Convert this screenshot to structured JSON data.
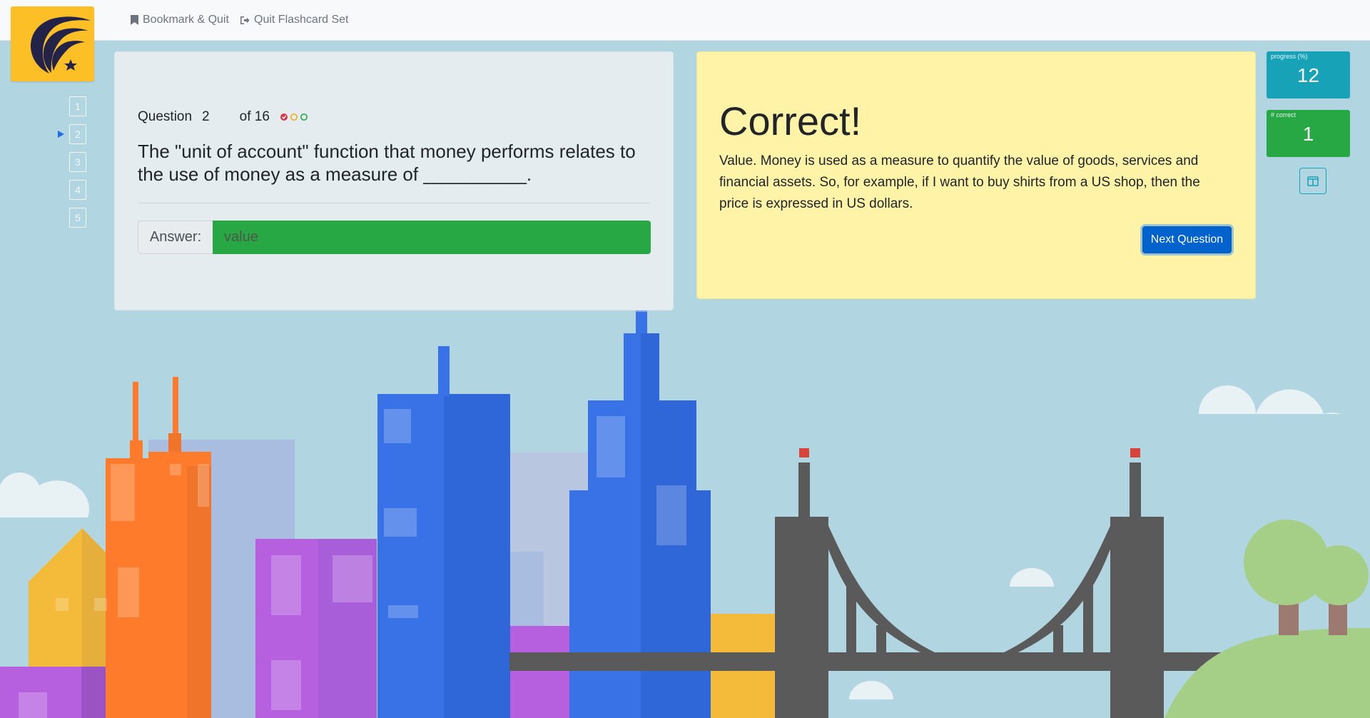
{
  "nav": {
    "bookmark_label": "Bookmark & Quit",
    "quit_label": "Quit Flashcard Set"
  },
  "sidebar": {
    "items": [
      "1",
      "2",
      "3",
      "4",
      "5"
    ],
    "current": 2
  },
  "question": {
    "label": "Question",
    "number": "2",
    "total_label": "of 16",
    "text": "The \"unit of account\" function that money performs relates to the use of money as a measure of __________.",
    "answer_label": "Answer:",
    "answer_value": "value"
  },
  "feedback": {
    "title": "Correct!",
    "body": "Value. Money is used as a measure to quantify the value of goods, services and financial assets. So, for example, if I want to buy shirts from a US shop, then the price is expressed in US dollars.",
    "next_label": "Next Question"
  },
  "stats": {
    "progress_label": "progress (%)",
    "progress_value": "12",
    "correct_label": "# correct",
    "correct_value": "1"
  },
  "colors": {
    "sky": "#b2d6e1",
    "logo_bg": "#fdbf26",
    "correct_green": "#28a745",
    "feedback_yellow": "#fff3a8",
    "progress_teal": "#17a2b8",
    "primary_blue": "#0062cc"
  },
  "icons": {
    "bookmark": "bookmark-icon",
    "quit": "sign-out-icon",
    "layout": "columns-icon",
    "status_correct": "check-circle-icon",
    "status_pending": "circle-icon"
  }
}
